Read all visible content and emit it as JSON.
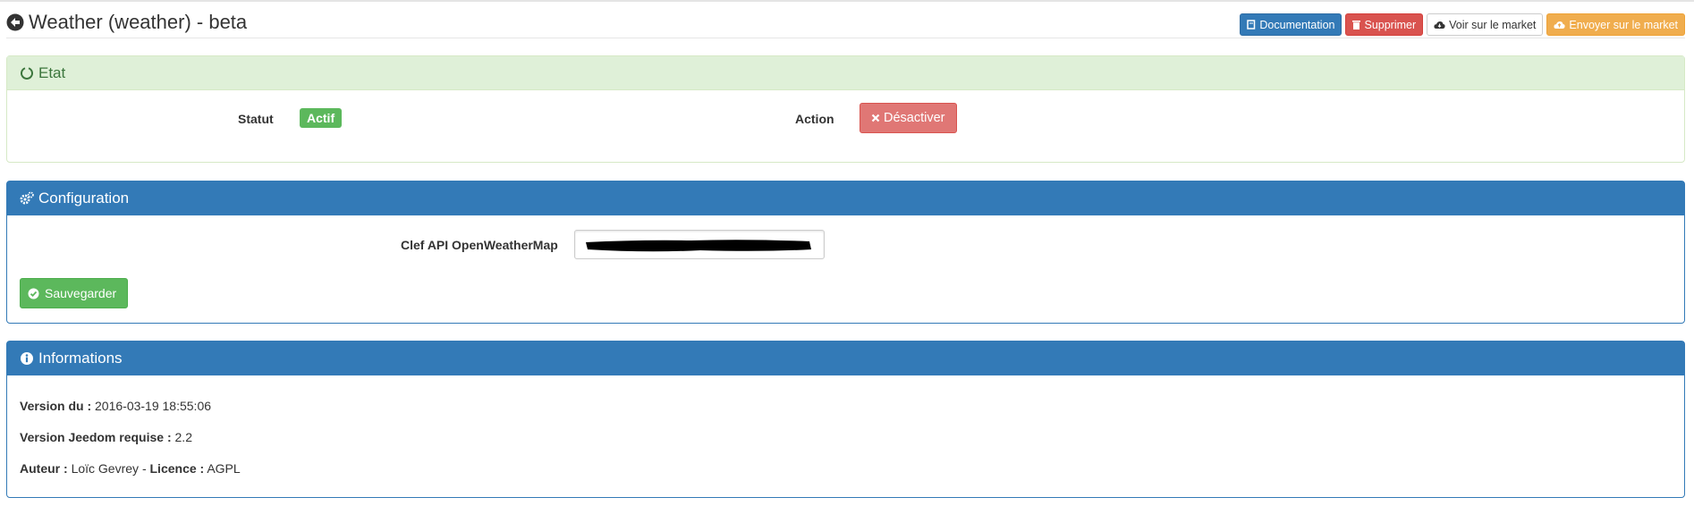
{
  "header": {
    "title": "Weather (weather) - beta",
    "buttons": {
      "documentation": "Documentation",
      "delete": "Supprimer",
      "market_view": "Voir sur le market",
      "market_send": "Envoyer sur le market"
    }
  },
  "etat": {
    "title": "Etat",
    "status_label": "Statut",
    "status_value": "Actif",
    "action_label": "Action",
    "deactivate_button": "Désactiver"
  },
  "configuration": {
    "title": "Configuration",
    "api_label": "Clef API OpenWeatherMap",
    "save_button": "Sauvegarder"
  },
  "informations": {
    "title": "Informations",
    "version_label": "Version du :",
    "version_value": "2016-03-19 18:55:06",
    "jeedom_label": "Version Jeedom requise :",
    "jeedom_value": "2.2",
    "author_label": "Auteur :",
    "author_value": "Loïc Gevrey",
    "separator": "-",
    "license_label": "Licence :",
    "license_value": "AGPL"
  },
  "colors": {
    "primary": "#337ab7",
    "success": "#5cb85c",
    "danger": "#d9534f",
    "warning": "#f0ad4e"
  },
  "icons": [
    "arrow-circle-left-icon",
    "book-icon",
    "trash-icon",
    "cloud-download-icon",
    "cloud-upload-icon",
    "circle-notch-icon",
    "cogs-icon",
    "times-icon",
    "check-circle-icon",
    "info-circle-icon"
  ]
}
